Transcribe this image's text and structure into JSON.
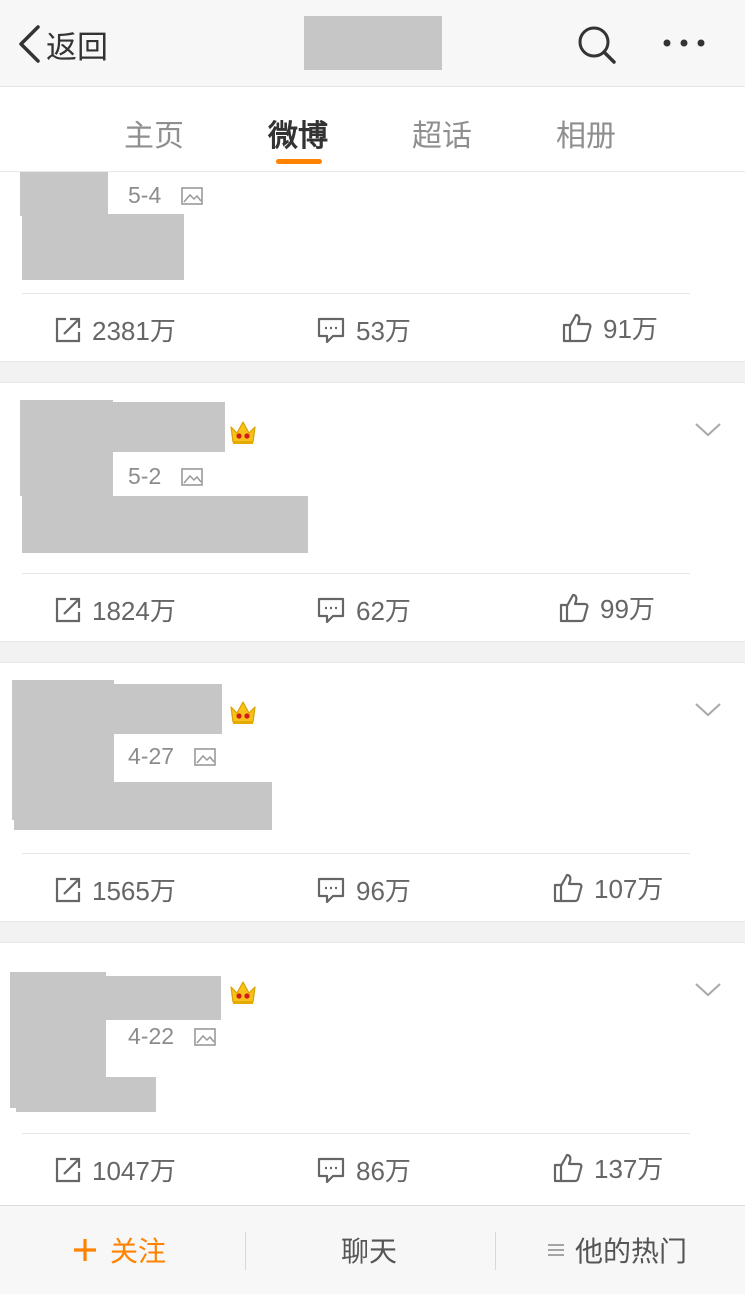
{
  "header": {
    "back_label": "返回"
  },
  "tabs": [
    {
      "label": "主页",
      "active": false
    },
    {
      "label": "微博",
      "active": true
    },
    {
      "label": "超话",
      "active": false
    },
    {
      "label": "相册",
      "active": false
    }
  ],
  "posts": [
    {
      "date": "5-4",
      "repost": "2381万",
      "comment": "53万",
      "like": "91万"
    },
    {
      "date": "5-2",
      "repost": "1824万",
      "comment": "62万",
      "like": "99万"
    },
    {
      "date": "4-27",
      "repost": "1565万",
      "comment": "96万",
      "like": "107万"
    },
    {
      "date": "4-22",
      "repost": "1047万",
      "comment": "86万",
      "like": "137万"
    }
  ],
  "bottom": {
    "follow_label": "关注",
    "chat_label": "聊天",
    "hot_label": "他的热门"
  },
  "colors": {
    "accent": "#ff8200",
    "redacted": "#c6c6c6"
  },
  "icons": [
    "chevron-left-icon",
    "search-icon",
    "more-icon",
    "picture-icon",
    "crown-icon",
    "chevron-down-icon",
    "repost-icon",
    "comment-icon",
    "like-icon",
    "plus-icon",
    "list-icon"
  ]
}
